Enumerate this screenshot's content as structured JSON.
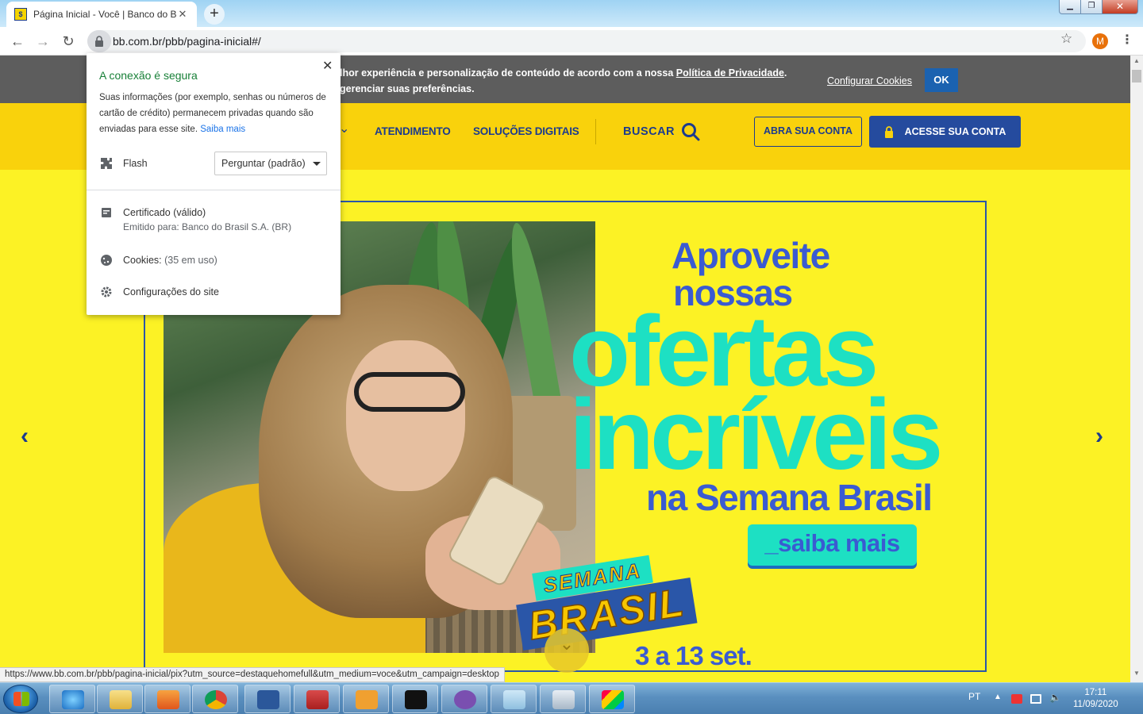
{
  "browser": {
    "tab_title": "Página Inicial - Você | Banco do B",
    "tab_close": "✕",
    "new_tab": "+",
    "url": "bb.com.br/pbb/pagina-inicial#/",
    "profile_initial": "M",
    "window_controls": {
      "minimize": "▁",
      "maximize": "❐",
      "close": "✕"
    }
  },
  "site_info_popup": {
    "title": "A conexão é segura",
    "description": "Suas informações (por exemplo, senhas ou números de cartão de crédito) permanecem privadas quando são enviadas para esse site.",
    "learn_more": "Saiba mais",
    "flash_label": "Flash",
    "flash_value": "Perguntar (padrão)",
    "certificate_label": "Certificado (válido)",
    "certificate_issued": "Emitido para: Banco do Brasil S.A. (BR)",
    "cookies_label": "Cookies:",
    "cookies_count": "(35 em uso)",
    "site_settings": "Configurações do site"
  },
  "cookie_bar": {
    "text_line1_prefix": "lhor experiência e personalização de conteúdo de acordo com a nossa ",
    "privacy_link": "Política de Privacidade",
    "text_line1_suffix": ".",
    "text_line2": "gerenciar suas preferências.",
    "configure_link": "Configurar Cookies",
    "ok_button": "OK"
  },
  "nav": {
    "atendimento": "ATENDIMENTO",
    "solucoes": "SOLUÇÕES DIGITAIS",
    "buscar": "BUSCAR",
    "abra_conta": "ABRA SUA CONTA",
    "acesse_conta": "ACESSE SUA CONTA"
  },
  "banner": {
    "line1": "Aproveite",
    "line2": "nossas",
    "line3": "ofertas",
    "line4": "incríveis",
    "line5": "na Semana Brasil",
    "cta": "_saiba mais",
    "badge_top": "SEMANA",
    "badge_bottom": "BRASIL",
    "dates": "3 a 13 set."
  },
  "status_url": "https://www.bb.com.br/pbb/pagina-inicial/pix?utm_source=destaquehomefull&utm_medium=voce&utm_campaign=desktop",
  "taskbar": {
    "language": "PT",
    "time": "17:11",
    "date": "11/09/2020"
  },
  "colors": {
    "bb_yellow": "#fcf225",
    "bb_nav_yellow": "#f9d20c",
    "bb_blue": "#1c3b8e",
    "teal": "#1de0c3",
    "secure_green": "#188038"
  }
}
